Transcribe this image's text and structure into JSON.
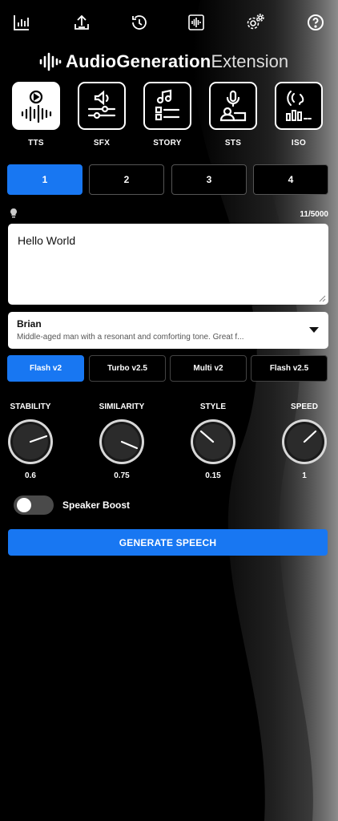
{
  "topbar": {
    "icons": [
      "chart-icon",
      "upload-icon",
      "history-icon",
      "waveform-icon",
      "settings-icon",
      "help-icon"
    ]
  },
  "logo": {
    "title": "AudioGeneration",
    "suffix": "Extension"
  },
  "modes": [
    {
      "label": "TTS",
      "icon": "play-wave-icon",
      "active": true
    },
    {
      "label": "SFX",
      "icon": "sound-effects-icon",
      "active": false
    },
    {
      "label": "STORY",
      "icon": "story-icon",
      "active": false
    },
    {
      "label": "STS",
      "icon": "microphone-icon",
      "active": false
    },
    {
      "label": "ISO",
      "icon": "isolate-icon",
      "active": false
    }
  ],
  "slots": [
    "1",
    "2",
    "3",
    "4"
  ],
  "active_slot": "1",
  "editor": {
    "counter": "11/5000",
    "text": "Hello World",
    "hint_icon": "lightbulb-icon"
  },
  "voice": {
    "name": "Brian",
    "description": "Middle-aged man with a resonant and comforting tone. Great f..."
  },
  "models": [
    "Flash v2",
    "Turbo v2.5",
    "Multi v2",
    "Flash v2.5"
  ],
  "active_model": "Flash v2",
  "knobs": [
    {
      "label": "STABILITY",
      "value": "0.6"
    },
    {
      "label": "SIMILARITY",
      "value": "0.75"
    },
    {
      "label": "STYLE",
      "value": "0.15"
    },
    {
      "label": "SPEED",
      "value": "1"
    }
  ],
  "speaker_boost": {
    "label": "Speaker Boost",
    "on": false
  },
  "generate_label": "GENERATE SPEECH",
  "colors": {
    "accent": "#1877f2",
    "background": "#000000"
  }
}
